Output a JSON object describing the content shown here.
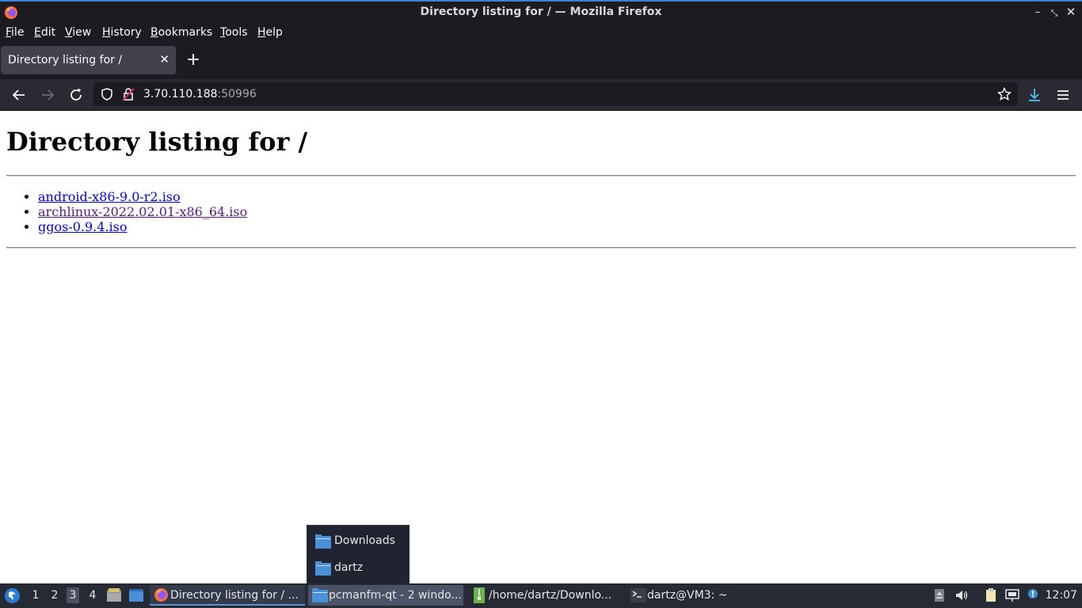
{
  "window": {
    "title": "Directory listing for / — Mozilla Firefox"
  },
  "menu": [
    "File",
    "Edit",
    "View",
    "History",
    "Bookmarks",
    "Tools",
    "Help"
  ],
  "tab": {
    "title": "Directory listing for /"
  },
  "urlbar": {
    "host": "3.70.110.188",
    "port": ":50996"
  },
  "page": {
    "heading": "Directory listing for /",
    "files": [
      {
        "name": "android-x86-9.0-r2.iso",
        "visited": false
      },
      {
        "name": "archlinux-2022.02.01-x86_64.iso",
        "visited": true
      },
      {
        "name": "ggos-0.9.4.iso",
        "visited": false
      }
    ]
  },
  "popup": {
    "items": [
      "Downloads",
      "dartz"
    ]
  },
  "taskbar": {
    "workspaces": [
      "1",
      "2",
      "3",
      "4"
    ],
    "active_workspace": "3",
    "tasks": [
      {
        "label": "Directory listing for / ...",
        "icon": "firefox-icon"
      },
      {
        "label": "pcmanfm-qt - 2 windo...",
        "icon": "folder-icon"
      },
      {
        "label": "/home/dartz/Downlo...",
        "icon": "archive-icon"
      },
      {
        "label": "dartz@VM3: ~",
        "icon": "terminal-icon"
      }
    ],
    "clock": "12:07"
  },
  "colors": {
    "accent": "#3f7fd1",
    "download_icon": "#4fc3f7",
    "link": "#0000ee",
    "visited_link": "#551a8b"
  }
}
